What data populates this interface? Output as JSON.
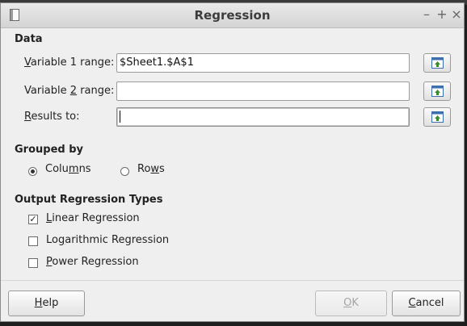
{
  "window": {
    "title": "Regression",
    "controls": {
      "minimize": "–",
      "maximize": "+",
      "close": "×"
    }
  },
  "data_section": {
    "heading": "Data",
    "variable1": {
      "label_pre": "",
      "label_key": "V",
      "label_post": "ariable 1 range:",
      "value": "$Sheet1.$A$1"
    },
    "variable2": {
      "label_pre": "Variable ",
      "label_key": "2",
      "label_post": " range:",
      "value": ""
    },
    "results": {
      "label_pre": "",
      "label_key": "R",
      "label_post": "esults to:",
      "value": ""
    },
    "shrink_icon": "shrink-selection-icon"
  },
  "grouped_by": {
    "heading": "Grouped by",
    "columns": {
      "label_pre": "Colu",
      "label_key": "m",
      "label_post": "ns",
      "selected": true
    },
    "rows": {
      "label_pre": "Ro",
      "label_key": "w",
      "label_post": "s",
      "selected": false
    }
  },
  "output_types": {
    "heading": "Output Regression Types",
    "linear": {
      "label_pre": "",
      "label_key": "L",
      "label_post": "inear Regression",
      "checked": true
    },
    "logarithmic": {
      "label_pre": "Lo",
      "label_key": "g",
      "label_post": "arithmic Regression",
      "checked": false
    },
    "power": {
      "label_pre": "",
      "label_key": "P",
      "label_post": "ower Regression",
      "checked": false
    }
  },
  "buttons": {
    "help": {
      "label_key": "H",
      "label_post": "elp"
    },
    "ok": {
      "label_key": "O",
      "label_post": "K",
      "enabled": false
    },
    "cancel": {
      "label_key": "C",
      "label_post": "ancel"
    }
  },
  "colors": {
    "window_bg": "#efefef",
    "title_text": "#3c3c3c",
    "disabled_text": "#a5a5a5",
    "icon_green": "#3a8a2e",
    "icon_blue": "#3d6fb0"
  }
}
